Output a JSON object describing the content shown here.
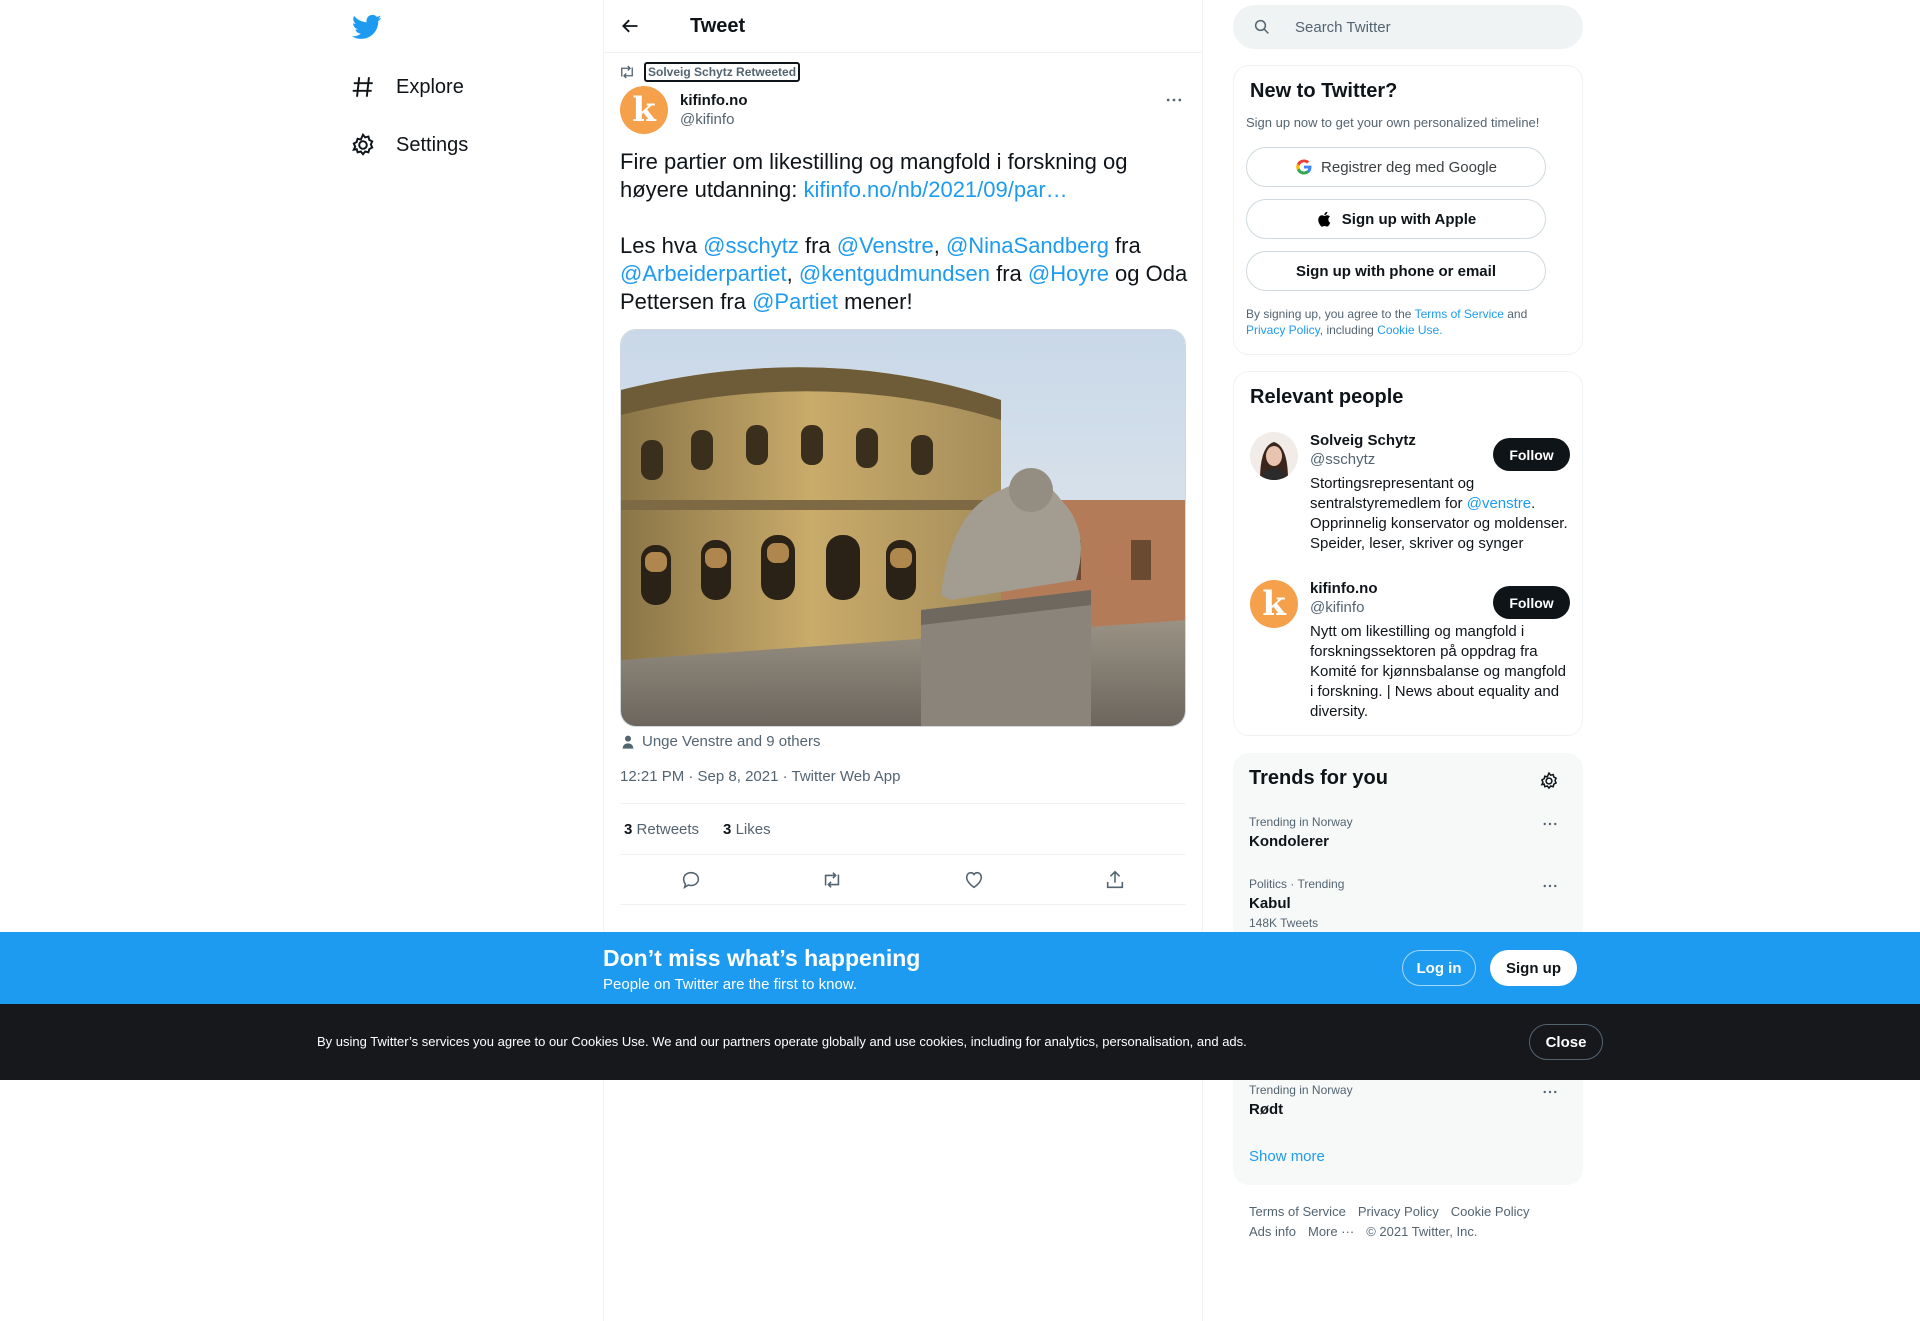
{
  "nav": {
    "items": [
      {
        "label": "Explore",
        "icon": "hashtag-icon"
      },
      {
        "label": "Settings",
        "icon": "gear-icon"
      }
    ]
  },
  "header": {
    "title": "Tweet"
  },
  "tweet": {
    "retweeted_by": "Solveig Schytz Retweeted",
    "author_name": "kifinfo.no",
    "author_handle": "@kifinfo",
    "avatar_letter": "k",
    "text_p1_a": "Fire partier om likestilling og mangfold i forskning og høyere utdanning: ",
    "text_p1_link": "kifinfo.no/nb/2021/09/par…",
    "text_p2": [
      {
        "t": "Les hva ",
        "link": false
      },
      {
        "t": "@sschytz",
        "link": true
      },
      {
        "t": " fra ",
        "link": false
      },
      {
        "t": "@Venstre",
        "link": true
      },
      {
        "t": ", ",
        "link": false
      },
      {
        "t": "@NinaSandberg",
        "link": true
      },
      {
        "t": " fra ",
        "link": false
      },
      {
        "t": "@Arbeiderpartiet",
        "link": true
      },
      {
        "t": ", ",
        "link": false
      },
      {
        "t": "@kentgudmundsen",
        "link": true
      },
      {
        "t": " fra ",
        "link": false
      },
      {
        "t": "@Hoyre",
        "link": true
      },
      {
        "t": " og Oda Pettersen fra ",
        "link": false
      },
      {
        "t": "@Partiet",
        "link": true
      },
      {
        "t": " mener!",
        "link": false
      }
    ],
    "tagged": "Unge Venstre and 9 others",
    "meta": "12:21 PM · Sep 8, 2021 · Twitter Web App",
    "retweets_count": "3",
    "retweets_label": "Retweets",
    "likes_count": "3",
    "likes_label": "Likes"
  },
  "search": {
    "placeholder": "Search Twitter"
  },
  "signup": {
    "title": "New to Twitter?",
    "subtitle": "Sign up now to get your own personalized timeline!",
    "google": "Registrer deg med Google",
    "apple": "Sign up with Apple",
    "phone": "Sign up with phone or email",
    "legal_a": "By signing up, you agree to the ",
    "legal_tos": "Terms of Service",
    "legal_and": " and",
    "legal_privacy": "Privacy Policy",
    "legal_including": ", including ",
    "legal_cookie": "Cookie Use."
  },
  "people": {
    "title": "Relevant people",
    "follow_label": "Follow",
    "list": [
      {
        "name": "Solveig Schytz",
        "handle": "@sschytz",
        "bio_a": "Stortingsrepresentant og sentralstyremedlem for ",
        "bio_link": "@venstre",
        "bio_b": ". Opprinnelig konservator og moldenser. Speider, leser, skriver og synger"
      },
      {
        "name": "kifinfo.no",
        "handle": "@kifinfo",
        "bio_a": "Nytt om likestilling og mangfold i forskningssektoren på oppdrag fra Komité for kjønnsbalanse og mangfold i forskning. | News about equality and diversity.",
        "bio_link": "",
        "bio_b": ""
      }
    ]
  },
  "trends": {
    "title": "Trends for you",
    "items": [
      {
        "category": "Trending in Norway",
        "name": "Kondolerer",
        "count": ""
      },
      {
        "category": "Politics · Trending",
        "name": "Kabul",
        "count": "148K Tweets"
      },
      {
        "category": "Trending in Norway",
        "name": "Rødt",
        "count": ""
      }
    ],
    "show_more": "Show more"
  },
  "footer": {
    "links": [
      "Terms of Service",
      "Privacy Policy",
      "Cookie Policy",
      "Ads info",
      "More ···",
      "© 2021 Twitter, Inc."
    ]
  },
  "banner": {
    "title": "Don’t miss what’s happening",
    "subtitle": "People on Twitter are the first to know.",
    "login": "Log in",
    "signup": "Sign up"
  },
  "cookie": {
    "text": "By using Twitter’s services you agree to our Cookies Use. We and our partners operate globally and use cookies, including for analytics, personalisation, and ads.",
    "close": "Close"
  },
  "colors": {
    "accent": "#1d9bf0",
    "dark": "#0f1419",
    "muted": "#536471",
    "kifinfo_orange": "#f5a04b"
  }
}
